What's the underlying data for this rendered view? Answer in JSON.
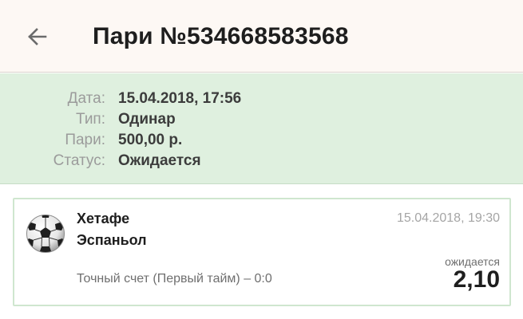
{
  "header": {
    "back_icon": "arrow-left-icon",
    "title": "Пари №534668583568"
  },
  "summary": {
    "rows": [
      {
        "label": "Дата:",
        "value": "15.04.2018, 17:56"
      },
      {
        "label": "Тип:",
        "value": "Одинар"
      },
      {
        "label": "Пари:",
        "value": "500,00 р."
      },
      {
        "label": "Статус:",
        "value": "Ожидается"
      }
    ]
  },
  "event": {
    "sport_icon": "soccer-ball-icon",
    "team1": "Хетафе",
    "team2": "Эспаньол",
    "date": "15.04.2018, 19:30",
    "market": "Точный счет (Первый тайм) – 0:0",
    "status": "ожидается",
    "odds": "2,10"
  },
  "colors": {
    "header_bg": "#fdf8f4",
    "summary_bg": "#dff0df",
    "card_border": "#cfe6cf",
    "label": "#9b9b9b",
    "value": "#3c3c3c"
  }
}
